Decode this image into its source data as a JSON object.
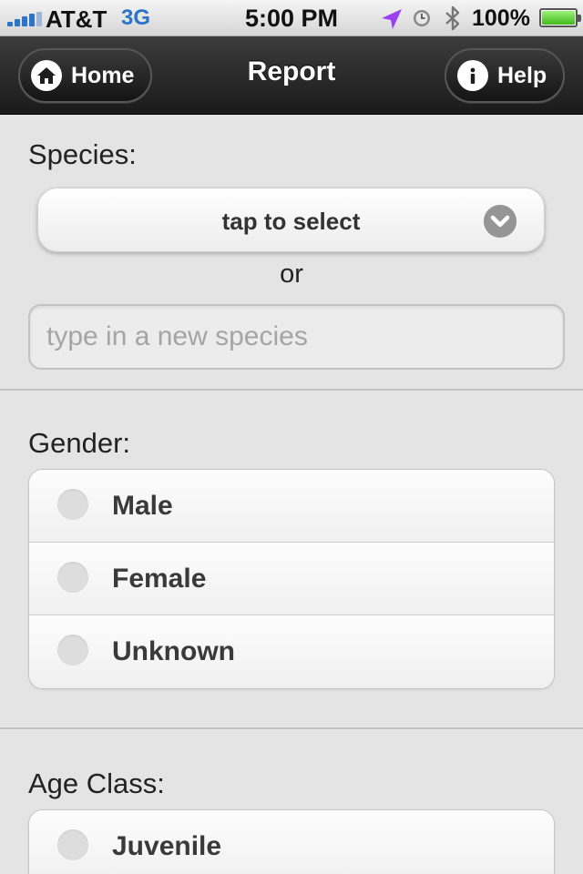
{
  "status_bar": {
    "carrier": "AT&T",
    "network": "3G",
    "time": "5:00 PM",
    "battery": "100%",
    "battery_level": 1.0,
    "icons": [
      "signal-icon",
      "location-arrow-icon",
      "alarm-clock-icon",
      "bluetooth-icon",
      "battery-icon"
    ]
  },
  "header": {
    "title": "Report",
    "home_label": "Home",
    "help_label": "Help",
    "home_icon": "home-icon",
    "help_icon": "info-icon"
  },
  "species": {
    "label": "Species:",
    "select_text": "tap to select",
    "or_text": "or",
    "input_placeholder": "type in a new species",
    "input_value": ""
  },
  "gender": {
    "label": "Gender:",
    "options": [
      "Male",
      "Female",
      "Unknown"
    ]
  },
  "age_class": {
    "label": "Age Class:",
    "options": [
      "Juvenile"
    ]
  },
  "colors": {
    "header_bg": "#1a1a1a",
    "page_bg": "#e4e4e4",
    "status_accent": "#2c74c8",
    "location_purple": "#9b3ff0"
  }
}
